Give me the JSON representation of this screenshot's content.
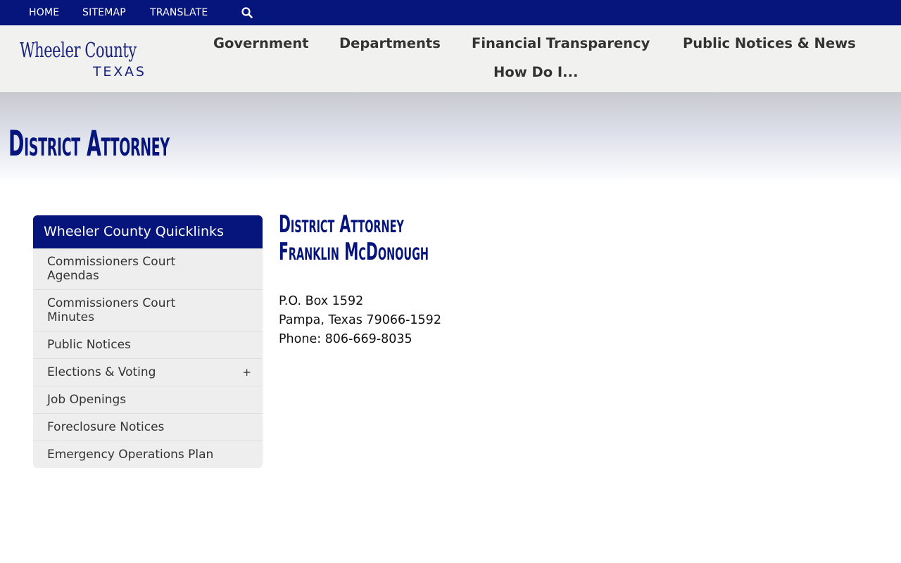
{
  "topbar": {
    "links": [
      "HOME",
      "SITEMAP",
      "TRANSLATE"
    ],
    "search_icon": "search-icon"
  },
  "header": {
    "logo_line1": "Wheeler County",
    "logo_line2": "TEXAS",
    "nav": [
      "Government",
      "Departments",
      "Financial Transparency",
      "Public Notices & News",
      "How Do I..."
    ]
  },
  "banner": {
    "title": "District Attorney"
  },
  "sidebar": {
    "heading": "Wheeler County Quicklinks",
    "items": [
      {
        "label": "Commissioners Court Agendas"
      },
      {
        "label": "Commissioners Court Minutes"
      },
      {
        "label": "Public Notices"
      },
      {
        "label": "Elections & Voting",
        "expand": "+"
      },
      {
        "label": "Job Openings"
      },
      {
        "label": "Foreclosure Notices"
      },
      {
        "label": "Emergency Operations Plan"
      }
    ]
  },
  "content": {
    "title_line1": "District Attorney",
    "title_line2": "Franklin McDonough",
    "address_line1": "P.O. Box 1592",
    "address_line2": "Pampa, Texas 79066-1592",
    "phone": "Phone: 806-669-8035"
  },
  "colors": {
    "brand_navy": "#06157c",
    "header_bg": "#f1f1f0",
    "sidebar_bg": "#eeeeee"
  }
}
